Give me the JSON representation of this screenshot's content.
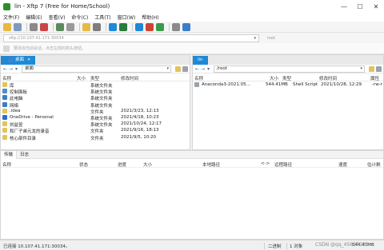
{
  "window": {
    "title": "lin - Xftp 7 (Free for Home/School)",
    "min": "—",
    "max": "☐",
    "close": "✕"
  },
  "menu": [
    "文件(F)",
    "编辑(E)",
    "查看(V)",
    "命令(C)",
    "工具(T)",
    "窗口(W)",
    "帮助(H)"
  ],
  "address": {
    "value": "sftp://10.107.41.171:30034",
    "root": "root"
  },
  "hint": "要添加当前会话，点击左侧的箭头按钮。",
  "colors": {
    "accent": "#1e8ad6",
    "folder": "#e2c35c"
  },
  "left": {
    "tabs": [
      {
        "label": "桌面",
        "active": true
      }
    ],
    "path": "桌面",
    "headers": {
      "name": "名称",
      "size": "大小",
      "type": "类型",
      "modified": "修改时间"
    },
    "files": [
      {
        "name": "库",
        "size": "",
        "type": "系统文件夹",
        "modified": "",
        "icon": "library-icon",
        "color": "#e2c35c"
      },
      {
        "name": "控制面板",
        "size": "",
        "type": "系统文件夹",
        "modified": "",
        "icon": "control-panel-icon",
        "color": "#4a8fd6"
      },
      {
        "name": "此电脑",
        "size": "",
        "type": "系统文件夹",
        "modified": "",
        "icon": "computer-icon",
        "color": "#3b7dc9"
      },
      {
        "name": "网络",
        "size": "",
        "type": "系统文件夹",
        "modified": "",
        "icon": "network-icon",
        "color": "#3b7dc9"
      },
      {
        "name": ".idea",
        "size": "",
        "type": "文件夹",
        "modified": "2021/3/23, 12:13",
        "icon": "folder-icon",
        "color": "#e2c35c"
      },
      {
        "name": "OneDrive - Personal",
        "size": "",
        "type": "系统文件夹",
        "modified": "2021/4/18, 10:23",
        "icon": "onedrive-icon",
        "color": "#2a6fd0"
      },
      {
        "name": "刘益昱",
        "size": "",
        "type": "系统文件夹",
        "modified": "2021/10/24, 12:17",
        "icon": "user-folder-icon",
        "color": "#e2c35c"
      },
      {
        "name": "和厂子弟元龙的录音",
        "size": "",
        "type": "文件夹",
        "modified": "2021/9/16, 18:13",
        "icon": "folder-icon",
        "color": "#e2c35c"
      },
      {
        "name": "核心部件目录",
        "size": "",
        "type": "文件夹",
        "modified": "2021/9/5, 10:20",
        "icon": "folder-icon",
        "color": "#e2c35c"
      }
    ]
  },
  "right": {
    "tabs": [
      {
        "label": "lin",
        "active": true
      }
    ],
    "path": "/root",
    "headers": {
      "name": "名称",
      "size": "大小",
      "type": "类型",
      "modified": "修改时间",
      "attr": "属性"
    },
    "files": [
      {
        "name": "Anaconda3-2021.05...",
        "size": "544.41MB",
        "type": "Shell Script",
        "modified": "2021/10/28, 12:29",
        "attr": "-rw-r",
        "icon": "file-icon",
        "color": "#9aa3ad"
      }
    ]
  },
  "transfer": {
    "tabs": [
      "传输",
      "日志"
    ],
    "headers": [
      "名称",
      "状态",
      "进度",
      "大小",
      "本地路径",
      "<->",
      "远程路径",
      "速度",
      "估计剩"
    ]
  },
  "status": {
    "connection": "已连接 10.107.41.171:30034。",
    "line_ending": "二进制",
    "objects": "1 对象",
    "size": "544.41MB",
    "watermark": "CSDN @qq_45697003"
  }
}
